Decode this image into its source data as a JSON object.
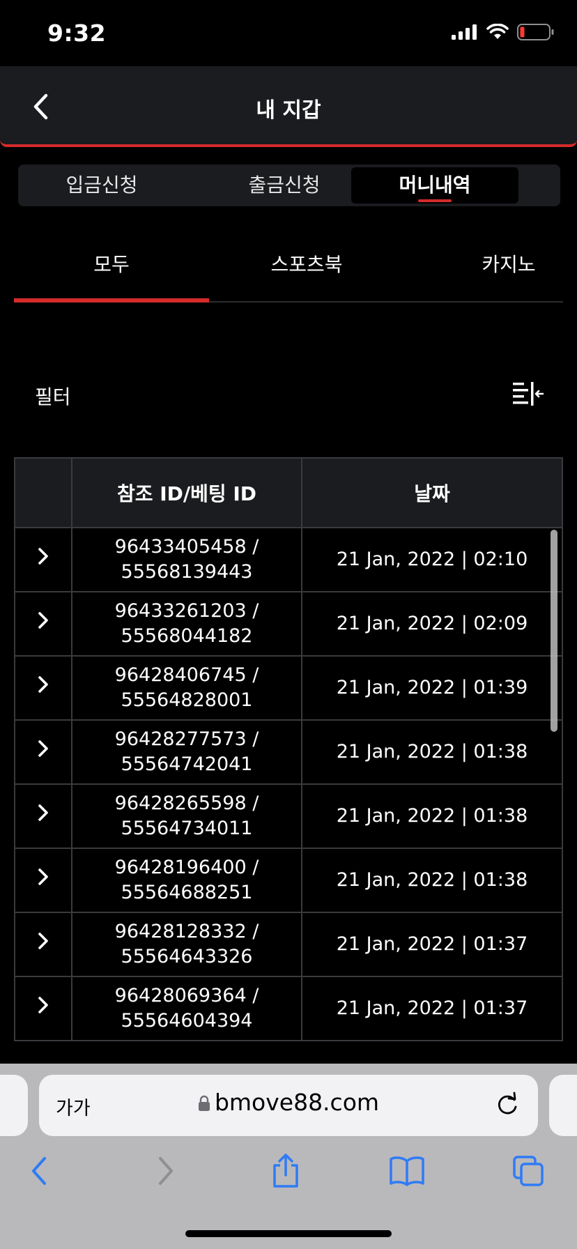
{
  "status": {
    "time": "9:32"
  },
  "header": {
    "title": "내 지갑"
  },
  "segment_tabs": [
    {
      "label": "입금신청"
    },
    {
      "label": "출금신청"
    },
    {
      "label": "머니내역"
    }
  ],
  "segment_active": "머니내역",
  "category_tabs": [
    {
      "label": "모두"
    },
    {
      "label": "스포츠북"
    },
    {
      "label": "카지노"
    }
  ],
  "category_active": "모두",
  "filter": {
    "label": "필터"
  },
  "table": {
    "headers": [
      "",
      "참조 ID/베팅 ID",
      "날짜"
    ],
    "rows": [
      {
        "ref_id": "96433405458 /",
        "bet_id": "55568139443",
        "date": "21 Jan, 2022 | 02:10"
      },
      {
        "ref_id": "96433261203 /",
        "bet_id": "55568044182",
        "date": "21 Jan, 2022 | 02:09"
      },
      {
        "ref_id": "96428406745 /",
        "bet_id": "55564828001",
        "date": "21 Jan, 2022 | 01:39"
      },
      {
        "ref_id": "96428277573 /",
        "bet_id": "55564742041",
        "date": "21 Jan, 2022 | 01:38"
      },
      {
        "ref_id": "96428265598 /",
        "bet_id": "55564734011",
        "date": "21 Jan, 2022 | 01:38"
      },
      {
        "ref_id": "96428196400 /",
        "bet_id": "55564688251",
        "date": "21 Jan, 2022 | 01:38"
      },
      {
        "ref_id": "96428128332 /",
        "bet_id": "55564643326",
        "date": "21 Jan, 2022 | 01:37"
      },
      {
        "ref_id": "96428069364 /",
        "bet_id": "55564604394",
        "date": "21 Jan, 2022 | 01:37"
      }
    ]
  },
  "browser": {
    "text_size_label": "가가",
    "url": "bmove88.com"
  },
  "colors": {
    "accent": "#d52b2b",
    "panel": "#1b1c1f",
    "background": "#000000",
    "browser_chrome": "#b9b9bc",
    "ios_blue": "#2f7bf5"
  },
  "icons": {
    "back": "chevron-left-icon",
    "filter": "filter-sort-icon",
    "row_expand": "chevron-right-icon",
    "lock": "lock-icon",
    "reload": "reload-icon",
    "signal": "cellular-signal-icon",
    "wifi": "wifi-icon",
    "battery": "battery-icon"
  }
}
